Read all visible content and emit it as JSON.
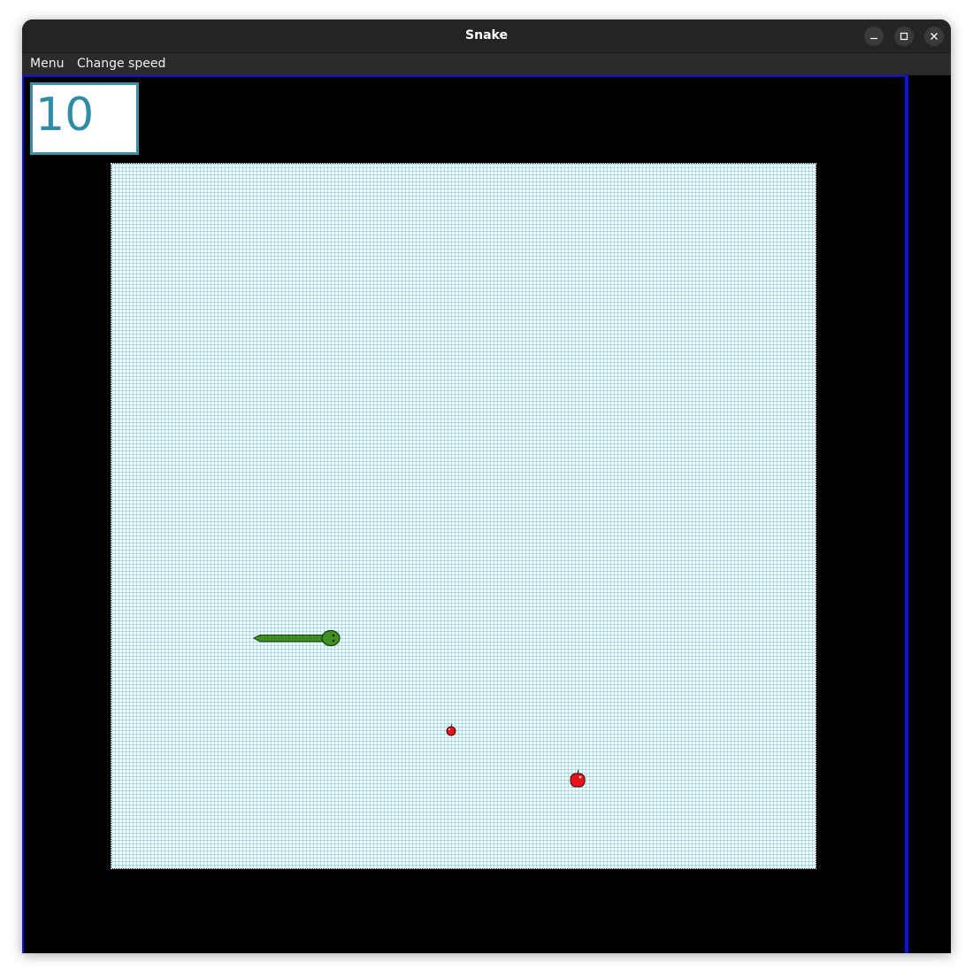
{
  "window": {
    "title": "Snake",
    "controls": {
      "minimize_icon": "minimize-icon",
      "maximize_icon": "maximize-icon",
      "close_icon": "close-icon"
    }
  },
  "menubar": {
    "items": [
      {
        "label": "Menu"
      },
      {
        "label": "Change speed"
      }
    ]
  },
  "game": {
    "score": "10",
    "colors": {
      "border": "#1010e0",
      "score_border": "#3a8fa6",
      "score_text": "#2e8ca6",
      "board_bg": "#f2fbfd",
      "grid": "#78c8dc",
      "snake": "#3f8f22",
      "apple": "#e8121a"
    },
    "snake": {
      "direction": "right",
      "icon": "snake-icon"
    },
    "apples": [
      {
        "icon": "apple-icon",
        "size": "small"
      },
      {
        "icon": "apple-icon",
        "size": "large"
      }
    ]
  }
}
